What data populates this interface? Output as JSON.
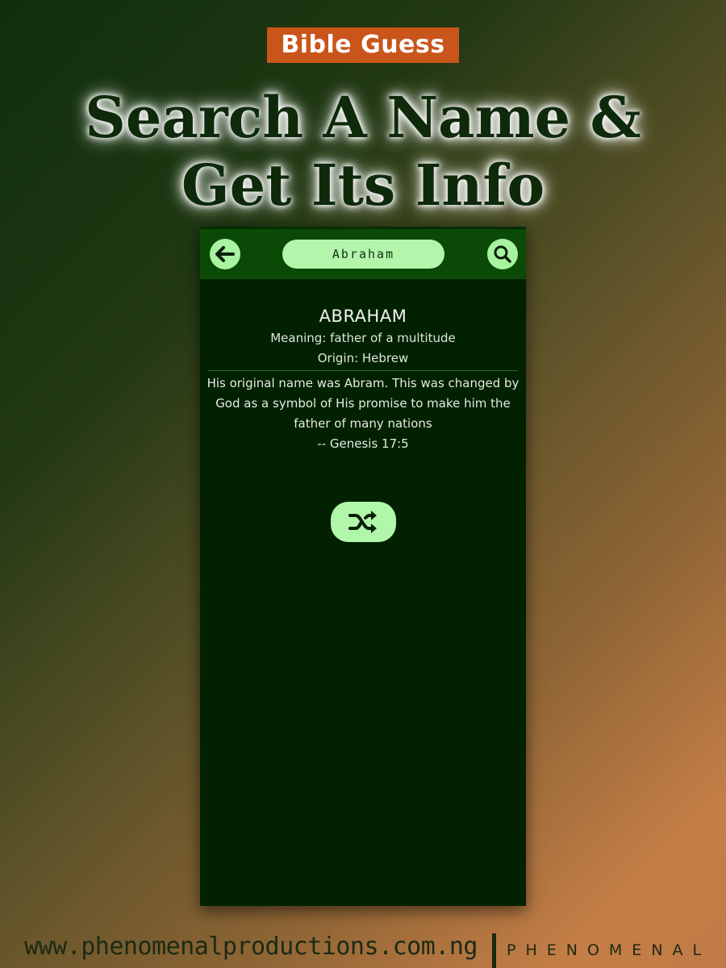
{
  "promo": {
    "badge": "Bible Guess",
    "headline_line1": "Search A Name &",
    "headline_line2": "Get Its Info"
  },
  "app": {
    "search": {
      "value": "Abraham"
    },
    "result": {
      "name": "ABRAHAM",
      "meaning": "Meaning: father of a multitude",
      "origin": "Origin: Hebrew",
      "description": "His original name was Abram. This was changed by God as a symbol of His promise to make him the father of many nations",
      "reference": "-- Genesis 17:5"
    },
    "icons": {
      "back": "arrow-left-icon",
      "search": "search-icon",
      "shuffle": "shuffle-icon"
    },
    "colors": {
      "screen_bg": "#012100",
      "appbar_bg": "#0a4a06",
      "accent": "#a8f3a0"
    }
  },
  "footer": {
    "url": "www.phenomenalproductions.com.ng",
    "brand": "PHENOMENAL"
  }
}
